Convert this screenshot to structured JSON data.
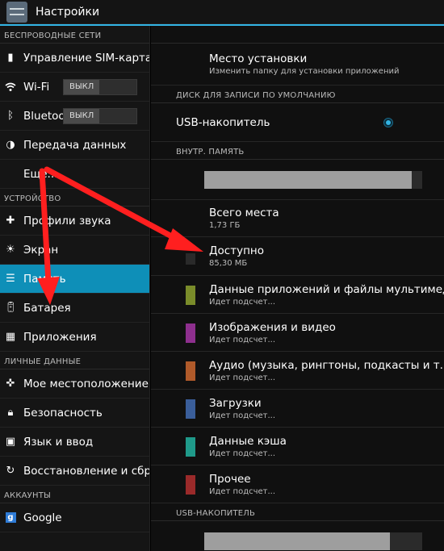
{
  "app": {
    "title": "Настройки"
  },
  "sidebar": {
    "sections": [
      {
        "header": "БЕСПРОВОДНЫЕ СЕТИ",
        "items": [
          {
            "label": "Управление SIM-картами",
            "icon": "sim-icon"
          },
          {
            "label": "Wi-Fi",
            "icon": "wifi-icon",
            "toggle": "ВЫКЛ"
          },
          {
            "label": "Bluetooth",
            "icon": "bluetooth-icon",
            "toggle": "ВЫКЛ"
          },
          {
            "label": "Передача данных",
            "icon": "data-usage-icon"
          },
          {
            "label": "Еще...",
            "icon": ""
          }
        ]
      },
      {
        "header": "УСТРОЙСТВО",
        "items": [
          {
            "label": "Профили звука",
            "icon": "sound-icon"
          },
          {
            "label": "Экран",
            "icon": "display-icon"
          },
          {
            "label": "Память",
            "icon": "storage-icon",
            "active": true
          },
          {
            "label": "Батарея",
            "icon": "battery-icon"
          },
          {
            "label": "Приложения",
            "icon": "apps-icon"
          }
        ]
      },
      {
        "header": "ЛИЧНЫЕ ДАННЫЕ",
        "items": [
          {
            "label": "Мое местоположение",
            "icon": "location-icon"
          },
          {
            "label": "Безопасность",
            "icon": "lock-icon"
          },
          {
            "label": "Язык и ввод",
            "icon": "keyboard-icon"
          },
          {
            "label": "Восстановление и сброс",
            "icon": "backup-icon"
          }
        ]
      },
      {
        "header": "АККАУНТЫ",
        "items": [
          {
            "label": "Google",
            "icon": "google-icon"
          }
        ]
      }
    ]
  },
  "main": {
    "install_location": {
      "title": "Место установки",
      "subtitle": "Изменить папку для установки приложений"
    },
    "default_disk_header": "ДИСК ДЛЯ ЗАПИСИ ПО УМОЛЧАНИЮ",
    "usb_option": {
      "label": "USB-накопитель",
      "selected": true
    },
    "internal_header": "ВНУТР. ПАМЯТЬ",
    "internal_bar_fill_percent": 95,
    "total": {
      "title": "Всего места",
      "value": "1,73 ГБ"
    },
    "available": {
      "title": "Доступно",
      "value": "85,30 МБ",
      "color": "#2a2a2a"
    },
    "categories": [
      {
        "title": "Данные приложений и файлы мультимедиа",
        "status": "Идет подсчет...",
        "color": "#7a8c2a"
      },
      {
        "title": "Изображения и видео",
        "status": "Идет подсчет...",
        "color": "#8e2f8e"
      },
      {
        "title": "Аудио (музыка, рингтоны, подкасты и т. п.)",
        "status": "Идет подсчет...",
        "color": "#b05a2a"
      },
      {
        "title": "Загрузки",
        "status": "Идет подсчет...",
        "color": "#3a5e9a"
      },
      {
        "title": "Данные кэша",
        "status": "Идет подсчет...",
        "color": "#1f9a8a"
      },
      {
        "title": "Прочее",
        "status": "Идет подсчет...",
        "color": "#9a2a2a"
      }
    ],
    "usb_header": "USB-НАКОПИТЕЛЬ",
    "usb_bar_fill_percent": 85
  },
  "annotation": {
    "arrow_color": "#ff1f1f"
  }
}
